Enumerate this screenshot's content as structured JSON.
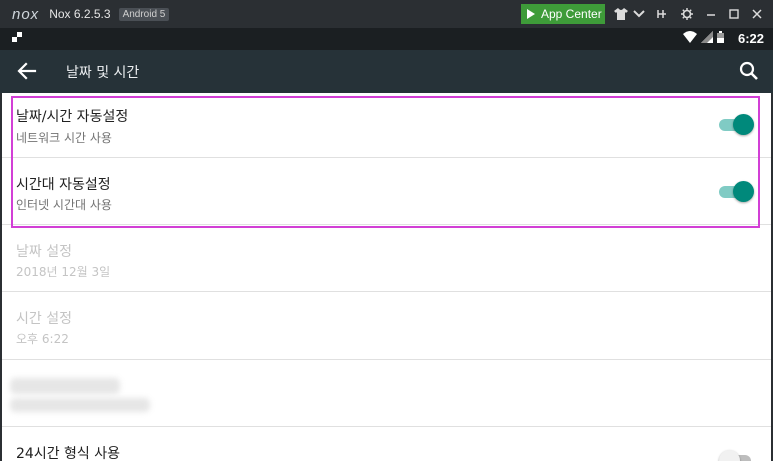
{
  "nox_bar": {
    "logo": "nox",
    "version": "Nox 6.2.5.3",
    "android_badge": "Android 5",
    "app_center_label": "App Center",
    "controls": [
      "shirt-icon",
      "chevron-down-icon",
      "pin-icon",
      "gear-icon",
      "minimize-icon",
      "maximize-icon",
      "close-icon"
    ],
    "accent_color": "#3e9b39"
  },
  "status_bar": {
    "time": "6:22",
    "icons": [
      "flag-icon",
      "wifi-icon",
      "signal-icon",
      "battery-icon"
    ]
  },
  "toolbar": {
    "title": "날짜 및 시간",
    "back_icon": "arrow-back-icon",
    "search_icon": "search-icon",
    "background_color": "#263238"
  },
  "settings": [
    {
      "title": "날짜/시간 자동설정",
      "summary": "네트워크 시간 사용",
      "toggle": "on"
    },
    {
      "title": "시간대 자동설정",
      "summary": "인터넷 시간대 사용",
      "toggle": "on"
    },
    {
      "title": "날짜 설정",
      "summary": "2018년 12월 3일",
      "disabled": true
    },
    {
      "title": "시간 설정",
      "summary": "오후 6:22",
      "disabled": true
    },
    {
      "title": "24시간 형식 사용",
      "toggle": "off"
    }
  ],
  "colors": {
    "toggle_on": "#00897b",
    "highlight": "#d23fd6"
  }
}
